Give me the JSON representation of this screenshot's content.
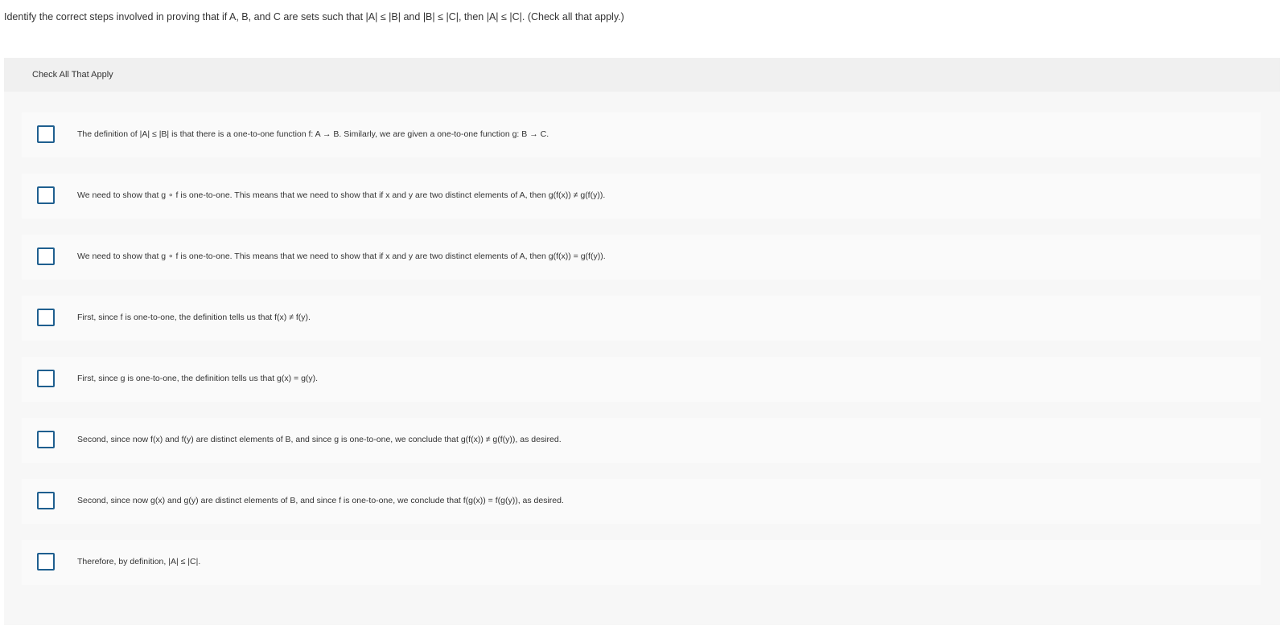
{
  "question": {
    "prompt": "Identify the correct steps involved in proving that if A, B, and C are sets such that |A| ≤ |B| and |B| ≤ |C|, then |A| ≤ |C|. (Check all that apply.)"
  },
  "panel": {
    "header_label": "Check All That Apply",
    "options": [
      {
        "text": "The definition of |A| ≤ |B| is that there is a one-to-one function f: A → B. Similarly, we are given a one-to-one function g: B → C.",
        "checked": false
      },
      {
        "text": "We need to show that g ∘ f is one-to-one. This means that we need to show that if x and y are two distinct elements of A, then g(f(x)) ≠ g(f(y)).",
        "checked": false
      },
      {
        "text": "We need to show that g ∘ f is one-to-one. This means that we need to show that if x and y are two distinct elements of A, then g(f(x)) = g(f(y)).",
        "checked": false
      },
      {
        "text": "First, since f is one-to-one, the definition tells us that f(x) ≠ f(y).",
        "checked": false
      },
      {
        "text": "First, since g is one-to-one, the definition tells us that g(x) = g(y).",
        "checked": false
      },
      {
        "text": "Second, since now f(x) and f(y) are distinct elements of B, and since g is one-to-one, we conclude that g(f(x)) ≠ g(f(y)), as desired.",
        "checked": false
      },
      {
        "text": "Second, since now g(x) and g(y) are distinct elements of B, and since f is one-to-one, we conclude that f(g(x)) = f(g(y)), as desired.",
        "checked": false
      },
      {
        "text": "Therefore, by definition, |A| ≤ |C|.",
        "checked": false
      }
    ]
  },
  "colors": {
    "checkbox_border": "#1f5f8f",
    "panel_background": "#f7f7f7",
    "header_background": "#f0f0f0",
    "option_background": "#fafafa",
    "text": "#333333"
  }
}
